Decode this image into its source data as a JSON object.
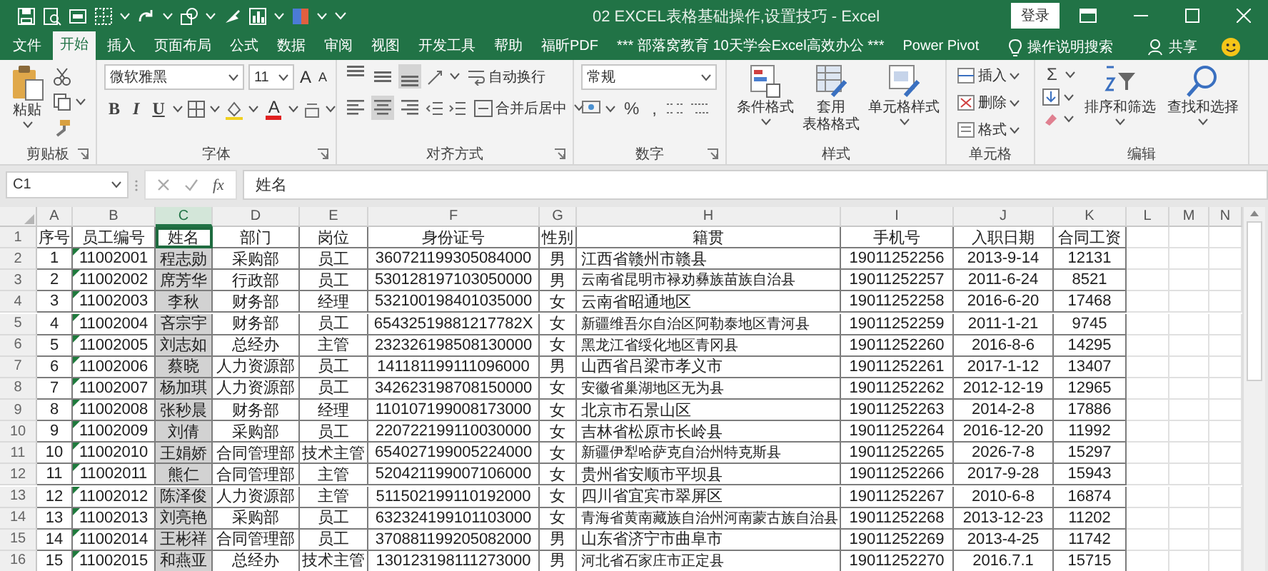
{
  "title_bar": {
    "title": "02 EXCEL表格基础操作,设置技巧 - Excel",
    "login_button": "登录"
  },
  "tabs": [
    {
      "label": "文件",
      "selected": false
    },
    {
      "label": "开始",
      "selected": true
    },
    {
      "label": "插入",
      "selected": false
    },
    {
      "label": "页面布局",
      "selected": false
    },
    {
      "label": "公式",
      "selected": false
    },
    {
      "label": "数据",
      "selected": false
    },
    {
      "label": "审阅",
      "selected": false
    },
    {
      "label": "视图",
      "selected": false
    },
    {
      "label": "开发工具",
      "selected": false
    },
    {
      "label": "帮助",
      "selected": false
    },
    {
      "label": "福昕PDF",
      "selected": false
    },
    {
      "label": "*** 部落窝教育 10天学会Excel高效办公 ***",
      "selected": false
    },
    {
      "label": "Power Pivot",
      "selected": false
    }
  ],
  "tell_me": "操作说明搜索",
  "share": "共享",
  "ribbon": {
    "clipboard": {
      "label": "剪贴板",
      "paste": "粘贴"
    },
    "font": {
      "label": "字体",
      "font_name": "微软雅黑",
      "font_size": "11",
      "grow": "A",
      "shrink": "A",
      "bold": "B",
      "italic": "I",
      "underline": "U",
      "font_color": "A"
    },
    "alignment": {
      "label": "对齐方式",
      "wrap_text": "自动换行",
      "merge_center": "合并后居中",
      "vertical_align": [
        {
          "kind": "top",
          "selected": false
        },
        {
          "kind": "middle",
          "selected": false
        },
        {
          "kind": "bottom",
          "selected": true
        }
      ],
      "horizontal_align": [
        {
          "kind": "left",
          "selected": false
        },
        {
          "kind": "center",
          "selected": true
        },
        {
          "kind": "right",
          "selected": false
        }
      ]
    },
    "number": {
      "label": "数字",
      "format": "常规",
      "percent": "%",
      "comma": ","
    },
    "styles": {
      "label": "样式",
      "conditional": "条件格式",
      "table_format": [
        "套用",
        "表格格式"
      ],
      "cell_style": "单元格样式"
    },
    "cells": {
      "label": "单元格",
      "insert": "插入",
      "delete": "删除",
      "format": "格式"
    },
    "editing": {
      "label": "编辑",
      "sum": "Σ",
      "sort_filter": "排序和筛选",
      "find_select": "查找和选择"
    }
  },
  "formula_bar": {
    "name_box": "C1",
    "fx": "fx",
    "formula": "姓名"
  },
  "sheet": {
    "columns": [
      {
        "letter": "A",
        "selected": false
      },
      {
        "letter": "B",
        "selected": false
      },
      {
        "letter": "C",
        "selected": true
      },
      {
        "letter": "D",
        "selected": false
      },
      {
        "letter": "E",
        "selected": false
      },
      {
        "letter": "F",
        "selected": false
      },
      {
        "letter": "G",
        "selected": false
      },
      {
        "letter": "H",
        "selected": false
      },
      {
        "letter": "I",
        "selected": false
      },
      {
        "letter": "J",
        "selected": false
      },
      {
        "letter": "K",
        "selected": false
      },
      {
        "letter": "L",
        "selected": false
      },
      {
        "letter": "M",
        "selected": false
      },
      {
        "letter": "N",
        "selected": false
      }
    ],
    "rows": [
      {
        "number": "1",
        "flag": false,
        "cells": [
          "序号",
          "员工编号",
          "姓名",
          "部门",
          "岗位",
          "身份证号",
          "性别",
          "籍贯",
          "手机号",
          "入职日期",
          "合同工资"
        ]
      },
      {
        "number": "2",
        "flag": true,
        "cells": [
          "1",
          "11002001",
          "程志勋",
          "采购部",
          "员工",
          "360721199305084000",
          "男",
          "江西省赣州市赣县",
          "19011252256",
          "2013-9-14",
          "12131"
        ]
      },
      {
        "number": "3",
        "flag": true,
        "cells": [
          "2",
          "11002002",
          "席芳华",
          "行政部",
          "员工",
          "530128197103050000",
          "男",
          "云南省昆明市禄劝彝族苗族自治县",
          "19011252257",
          "2011-6-24",
          "8521"
        ]
      },
      {
        "number": "4",
        "flag": true,
        "cells": [
          "3",
          "11002003",
          "李秋",
          "财务部",
          "经理",
          "532100198401035000",
          "女",
          "云南省昭通地区",
          "19011252258",
          "2016-6-20",
          "17468"
        ]
      },
      {
        "number": "5",
        "flag": true,
        "cells": [
          "4",
          "11002004",
          "吝宗宇",
          "财务部",
          "员工",
          "65432519881217782X",
          "女",
          "新疆维吾尔自治区阿勒泰地区青河县",
          "19011252259",
          "2011-1-21",
          "9745"
        ]
      },
      {
        "number": "6",
        "flag": true,
        "cells": [
          "5",
          "11002005",
          "刘志如",
          "总经办",
          "主管",
          "232326198508130000",
          "女",
          "黑龙江省绥化地区青冈县",
          "19011252260",
          "2016-8-6",
          "14295"
        ]
      },
      {
        "number": "7",
        "flag": true,
        "cells": [
          "6",
          "11002006",
          "蔡晓",
          "人力资源部",
          "员工",
          "141181199111096000",
          "男",
          "山西省吕梁市孝义市",
          "19011252261",
          "2017-1-12",
          "13407"
        ]
      },
      {
        "number": "8",
        "flag": true,
        "cells": [
          "7",
          "11002007",
          "杨加琪",
          "人力资源部",
          "员工",
          "342623198708150000",
          "女",
          "安徽省巢湖地区无为县",
          "19011252262",
          "2012-12-19",
          "12965"
        ]
      },
      {
        "number": "9",
        "flag": true,
        "cells": [
          "8",
          "11002008",
          "张秒晨",
          "财务部",
          "经理",
          "110107199008173000",
          "女",
          "北京市石景山区",
          "19011252263",
          "2014-2-8",
          "17886"
        ]
      },
      {
        "number": "10",
        "flag": true,
        "cells": [
          "9",
          "11002009",
          "刘倩",
          "采购部",
          "员工",
          "220722199110030000",
          "女",
          "吉林省松原市长岭县",
          "19011252264",
          "2016-12-20",
          "11992"
        ]
      },
      {
        "number": "11",
        "flag": true,
        "cells": [
          "10",
          "11002010",
          "王娟娇",
          "合同管理部",
          "技术主管",
          "654027199005224000",
          "女",
          "新疆伊犁哈萨克自治州特克斯县",
          "19011252265",
          "2026-7-8",
          "15297"
        ]
      },
      {
        "number": "12",
        "flag": true,
        "cells": [
          "11",
          "11002011",
          "熊仁",
          "合同管理部",
          "主管",
          "520421199007106000",
          "女",
          "贵州省安顺市平坝县",
          "19011252266",
          "2017-9-28",
          "15943"
        ]
      },
      {
        "number": "13",
        "flag": true,
        "cells": [
          "12",
          "11002012",
          "陈泽俊",
          "人力资源部",
          "主管",
          "511502199110192000",
          "女",
          "四川省宜宾市翠屏区",
          "19011252267",
          "2010-6-8",
          "16874"
        ]
      },
      {
        "number": "14",
        "flag": true,
        "cells": [
          "13",
          "11002013",
          "刘亮艳",
          "采购部",
          "员工",
          "632324199101103000",
          "女",
          "青海省黄南藏族自治州河南蒙古族自治县",
          "19011252268",
          "2013-12-23",
          "11202"
        ]
      },
      {
        "number": "15",
        "flag": true,
        "cells": [
          "14",
          "11002014",
          "王彬祥",
          "合同管理部",
          "员工",
          "370881199205082000",
          "男",
          "山东省济宁市曲阜市",
          "19011252269",
          "2013-4-25",
          "11742"
        ]
      },
      {
        "number": "16",
        "flag": true,
        "cells": [
          "15",
          "11002015",
          "和燕亚",
          "总经办",
          "技术主管",
          "130123198111273000",
          "男",
          "河北省石家庄市正定县",
          "19011252270",
          "2016.7.1",
          "15715"
        ]
      }
    ]
  }
}
